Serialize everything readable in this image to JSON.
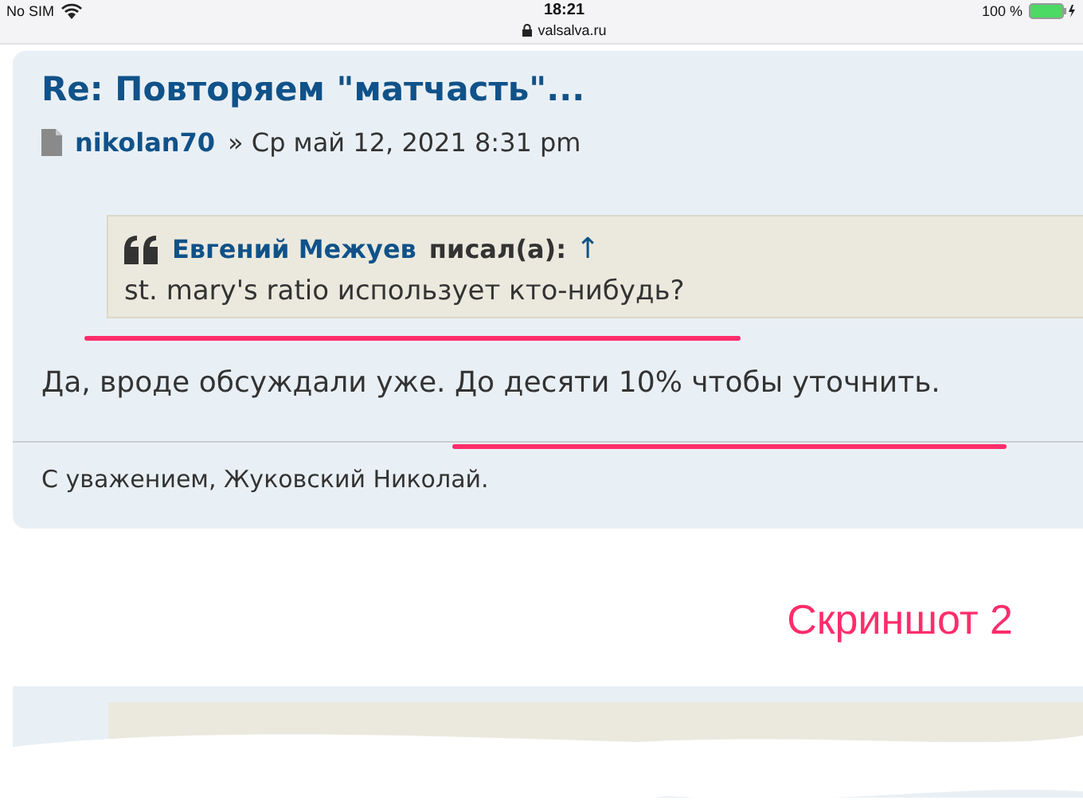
{
  "status_bar": {
    "carrier": "No SIM",
    "time": "18:21",
    "url": "valsalva.ru",
    "battery": "100 %"
  },
  "post": {
    "title": "Re: Повторяем \"матчасть\"...",
    "author": "nikolan70",
    "separator": "»",
    "date": "Ср май 12, 2021 8:31 pm",
    "quote": {
      "author": "Евгений Межуев",
      "wrote": "писал(а):",
      "link": "↑",
      "text": "st. mary's ratio использует кто-нибудь?"
    },
    "body": "Да, вроде обсуждали уже. До десяти 10% чтобы уточнить.",
    "signature": "С уважением, Жуковский Николай."
  },
  "annotation": {
    "label": "Скриншот 2"
  }
}
